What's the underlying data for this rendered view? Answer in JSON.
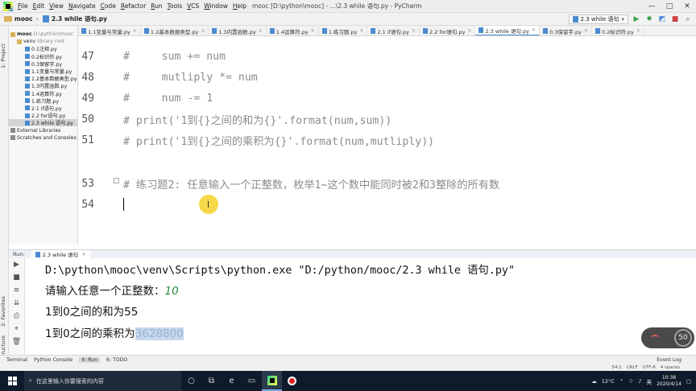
{
  "menu": {
    "items": [
      "File",
      "Edit",
      "View",
      "Navigate",
      "Code",
      "Refactor",
      "Run",
      "Tools",
      "VCS",
      "Window",
      "Help"
    ],
    "title": "mooc [D:\\python\\mooc] - ...\\2.3 while 语句.py - PyCharm"
  },
  "window_controls": [
    "—",
    "□",
    "✕"
  ],
  "navbar": {
    "project": "mooc",
    "file": "2.3 while 语句.py",
    "run_config": "2.3 while 语句"
  },
  "tool_strip": {
    "project": "1: Project",
    "favorites": "2: Favorites",
    "structure": "Z: Structure"
  },
  "project_tree": [
    {
      "label": "mooc",
      "note": "D:\\python\\mooc",
      "kind": "folder",
      "indent": 0
    },
    {
      "label": "venv",
      "note": "library root",
      "kind": "folder",
      "indent": 1
    },
    {
      "label": "0.1注释.py",
      "kind": "py",
      "indent": 1
    },
    {
      "label": "0.2标识符.py",
      "kind": "py",
      "indent": 1
    },
    {
      "label": "0.3保留字.py",
      "kind": "py",
      "indent": 1
    },
    {
      "label": "1.1变量与常量.py",
      "kind": "py",
      "indent": 1
    },
    {
      "label": "1.2基本数据类型.py",
      "kind": "py",
      "indent": 1
    },
    {
      "label": "1.3内置函数.py",
      "kind": "py",
      "indent": 1
    },
    {
      "label": "1.4运算符.py",
      "kind": "py",
      "indent": 1
    },
    {
      "label": "1.练习题.py",
      "kind": "py",
      "indent": 1
    },
    {
      "label": "2.1 if语句.py",
      "kind": "py",
      "indent": 1
    },
    {
      "label": "2.2 for语句.py",
      "kind": "py",
      "indent": 1
    },
    {
      "label": "2.3 while 语句.py",
      "kind": "py",
      "indent": 1,
      "selected": true
    },
    {
      "label": "External Libraries",
      "kind": "lib",
      "indent": 0
    },
    {
      "label": "Scratches and Consoles",
      "kind": "lib",
      "indent": 0
    }
  ],
  "editor_tabs": [
    {
      "label": "1.1变量与常量.py",
      "active": false
    },
    {
      "label": "1.2基本数据类型.py",
      "active": false
    },
    {
      "label": "1.3内置函数.py",
      "active": false
    },
    {
      "label": "1.4运算符.py",
      "active": false
    },
    {
      "label": "1.练习题.py",
      "active": false
    },
    {
      "label": "2.1 if语句.py",
      "active": false
    },
    {
      "label": "2.2 for语句.py",
      "active": false
    },
    {
      "label": "2.3 while 语句.py",
      "active": true
    },
    {
      "label": "0.3保留字.py",
      "active": false
    },
    {
      "label": "0.2标识符.py",
      "active": false
    }
  ],
  "code_lines": [
    {
      "num": "47",
      "text": "#     sum += num"
    },
    {
      "num": "48",
      "text": "#     mutliply *= num"
    },
    {
      "num": "49",
      "text": "#     num -= 1"
    },
    {
      "num": "50",
      "text": "# print('1到{}之间的和为{}'.format(num,sum))"
    },
    {
      "num": "51",
      "text": "# print('1到{}之间的乘积为{}'.format(num,mutliply))"
    },
    {
      "num": "53",
      "text": "# 练习题2: 任意输入一个正整数，枚举1~这个数中能同时被2和3整除的所有数"
    },
    {
      "num": "54",
      "text": ""
    }
  ],
  "run_panel": {
    "label": "Run:",
    "tab": "2.3 while 语句"
  },
  "console": {
    "command": "D:\\python\\mooc\\venv\\Scripts\\python.exe \"D:/python/mooc/2.3 while 语句.py\"",
    "prompt": "请输入任意一个正整数：",
    "input_value": "10",
    "sum_line": "1到0之间的和为55",
    "product_prefix": "1到0之间的乘积为",
    "product_value": "3628800"
  },
  "network_badge": "50",
  "bottom_tabs": [
    {
      "label": "Terminal",
      "active": false
    },
    {
      "label": "Python Console",
      "active": false
    },
    {
      "label": "4: Run",
      "active": true
    },
    {
      "label": "6: TODO",
      "active": false
    }
  ],
  "event_log": "Event Log",
  "status_bar": [
    "54:1",
    "CRLF",
    "UTF-8",
    "4 spaces"
  ],
  "taskbar": {
    "search_placeholder": "在这里输入你要搜索的内容",
    "weather": "12°C",
    "lang": "英",
    "time": "10:38",
    "date": "2020/4/14"
  }
}
